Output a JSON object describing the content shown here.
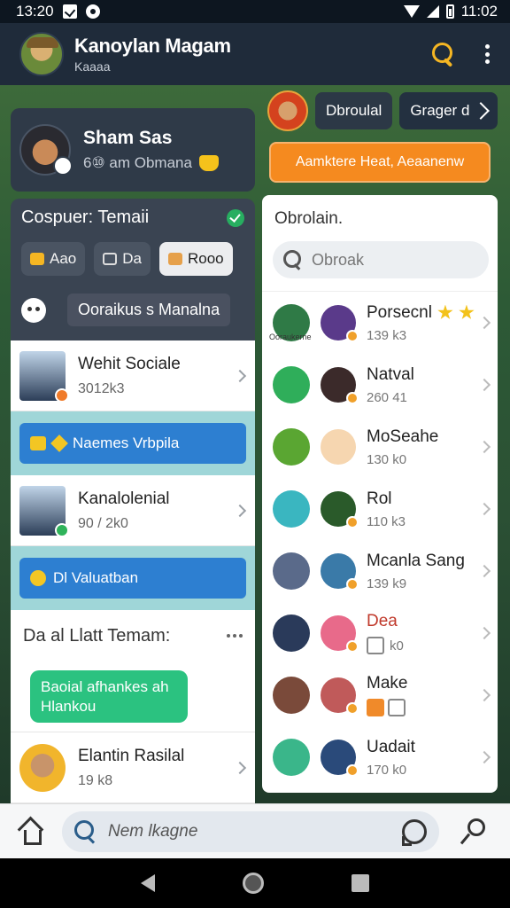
{
  "status": {
    "time": "13:20",
    "clock": "11:02"
  },
  "appbar": {
    "title": "Kanoylan Magam",
    "subtitle": "Kaaaa"
  },
  "profile": {
    "name": "Sham Sas",
    "subtitle": "6⑩ am Obmana"
  },
  "settings": {
    "title": "Cospuer: Temaii",
    "chips": [
      "Aao",
      "Da",
      "Rooo"
    ],
    "pill": "Ooraikus s Manalna"
  },
  "left_list": [
    {
      "name": "Wehit Sociale",
      "meta": "3012k3"
    },
    {
      "name": "Kanalolenial",
      "meta": "90 / 2k0"
    }
  ],
  "banners": [
    "Naemes Vrbpila",
    "Dl Valuatban"
  ],
  "section": {
    "title": "Da al Llatt Temam:"
  },
  "chat": {
    "bubble": "Baoial afhankes ah Hlankou"
  },
  "bottom_row": {
    "name": "Elantin Rasilal",
    "meta": "19 k8"
  },
  "right": {
    "tabs": [
      "Dbroulal",
      "Grager d"
    ],
    "orange_button": "Aamktere Heat, Aeaanenw",
    "card_title": "Obrolain.",
    "search_placeholder": "Obroak",
    "items": [
      {
        "name": "Porsecnl",
        "meta": "139 k3",
        "ribbon": "Ooraukerne"
      },
      {
        "name": "Natval",
        "meta": "260 41"
      },
      {
        "name": "MoSeahe",
        "meta": "130 k0"
      },
      {
        "name": "Rol",
        "meta": "110 k3"
      },
      {
        "name": "Mcanla Sang",
        "meta": "139 k9"
      },
      {
        "name": "Dea",
        "meta": "k0"
      },
      {
        "name": "Make",
        "meta": ""
      },
      {
        "name": "Uadait",
        "meta": "170 k0"
      }
    ]
  },
  "bottombar": {
    "search_placeholder": "Nem lkagne"
  },
  "colors": {
    "accent": "#f5b623",
    "orange": "#f58a1f",
    "blue": "#2d7fd1",
    "green": "#2bc280"
  }
}
